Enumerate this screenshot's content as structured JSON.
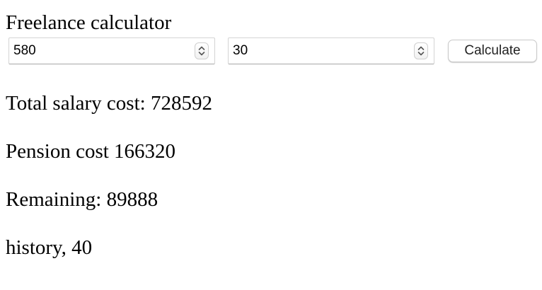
{
  "page": {
    "title": "Freelance calculator"
  },
  "form": {
    "first_value": "580",
    "second_value": "30",
    "calculate_label": "Calculate"
  },
  "results": {
    "total_salary_cost": "Total salary cost: 728592",
    "pension_cost": "Pension cost 166320",
    "remaining": "Remaining: 89888",
    "history": "history, 40"
  },
  "icons": {
    "stepper": "up-down-chevron-icon"
  }
}
